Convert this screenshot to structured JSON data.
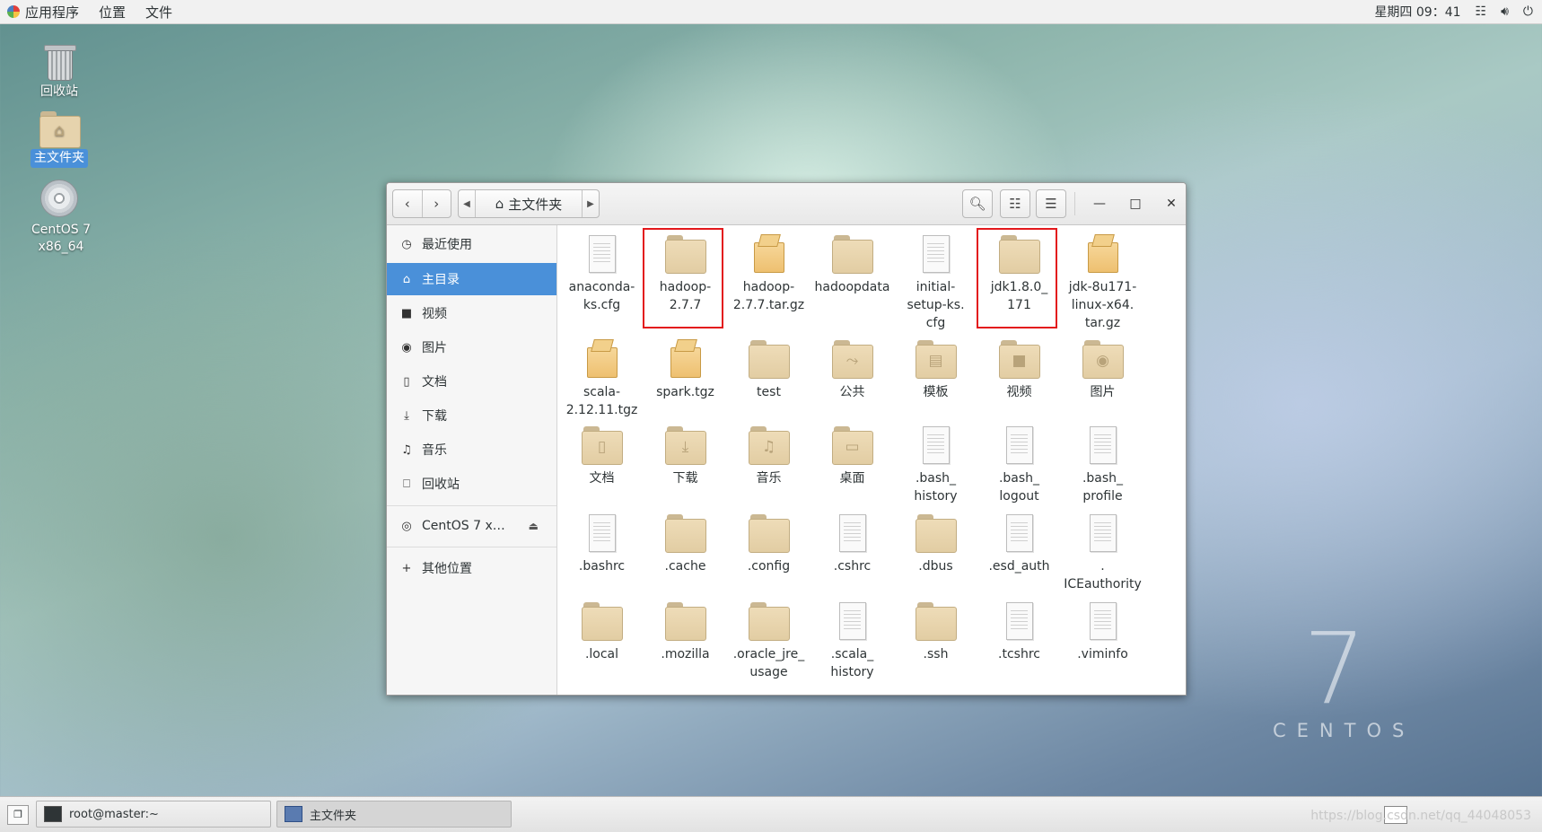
{
  "topbar": {
    "menu": [
      "应用程序",
      "位置",
      "文件"
    ],
    "clock": "星期四 09：41",
    "icons": [
      "network-icon",
      "volume-icon",
      "power-icon"
    ]
  },
  "desktop": {
    "icons": [
      {
        "name": "trash",
        "label": "回收站"
      },
      {
        "name": "home",
        "label": "主文件夹"
      },
      {
        "name": "dvd",
        "label": "CentOS 7 x86_64"
      }
    ],
    "brand_number": "7",
    "brand_text": "CENTOS"
  },
  "window": {
    "path": "主文件夹",
    "sidebar": [
      {
        "label": "最近使用",
        "icon": "clock-icon"
      },
      {
        "label": "主目录",
        "icon": "home-icon",
        "active": true
      },
      {
        "label": "视频",
        "icon": "video-icon"
      },
      {
        "label": "图片",
        "icon": "camera-icon"
      },
      {
        "label": "文档",
        "icon": "document-icon"
      },
      {
        "label": "下载",
        "icon": "download-icon"
      },
      {
        "label": "音乐",
        "icon": "music-icon"
      },
      {
        "label": "回收站",
        "icon": "trash-icon"
      },
      {
        "label": "CentOS 7 x…",
        "icon": "disc-icon",
        "eject": true
      },
      {
        "label": "其他位置",
        "icon": "plus-icon"
      }
    ],
    "files": [
      {
        "label": "anaconda-\nks.cfg",
        "type": "doc"
      },
      {
        "label": "hadoop-\n2.7.7",
        "type": "folder",
        "highlight": true
      },
      {
        "label": "hadoop-\n2.7.7.tar.gz",
        "type": "pkg"
      },
      {
        "label": "hadoopdata",
        "type": "folder"
      },
      {
        "label": "initial-\nsetup-ks.\ncfg",
        "type": "doc"
      },
      {
        "label": "jdk1.8.0_\n171",
        "type": "folder",
        "highlight": true
      },
      {
        "label": "jdk-8u171-\nlinux-x64.\ntar.gz",
        "type": "pkg"
      },
      {
        "label": "scala-\n2.12.11.tgz",
        "type": "pkg"
      },
      {
        "label": "spark.tgz",
        "type": "pkg"
      },
      {
        "label": "test",
        "type": "folder"
      },
      {
        "label": "公共",
        "type": "folder",
        "emblem": "share"
      },
      {
        "label": "模板",
        "type": "folder",
        "emblem": "template"
      },
      {
        "label": "视频",
        "type": "folder",
        "emblem": "video"
      },
      {
        "label": "图片",
        "type": "folder",
        "emblem": "camera"
      },
      {
        "label": "文档",
        "type": "folder",
        "emblem": "document"
      },
      {
        "label": "下载",
        "type": "folder",
        "emblem": "download"
      },
      {
        "label": "音乐",
        "type": "folder",
        "emblem": "music"
      },
      {
        "label": "桌面",
        "type": "folder",
        "emblem": "desktop"
      },
      {
        "label": ".bash_\nhistory",
        "type": "doc"
      },
      {
        "label": ".bash_\nlogout",
        "type": "doc"
      },
      {
        "label": ".bash_\nprofile",
        "type": "doc"
      },
      {
        "label": ".bashrc",
        "type": "doc"
      },
      {
        "label": ".cache",
        "type": "folder"
      },
      {
        "label": ".config",
        "type": "folder"
      },
      {
        "label": ".cshrc",
        "type": "doc"
      },
      {
        "label": ".dbus",
        "type": "folder"
      },
      {
        "label": ".esd_auth",
        "type": "doc"
      },
      {
        "label": ".\nICEauthority",
        "type": "doc"
      },
      {
        "label": ".local",
        "type": "folder"
      },
      {
        "label": ".mozilla",
        "type": "folder"
      },
      {
        "label": ".oracle_jre_\nusage",
        "type": "folder"
      },
      {
        "label": ".scala_\nhistory",
        "type": "doc"
      },
      {
        "label": ".ssh",
        "type": "folder"
      },
      {
        "label": ".tcshrc",
        "type": "doc"
      },
      {
        "label": ".viminfo",
        "type": "doc"
      }
    ]
  },
  "taskbar": {
    "tasks": [
      {
        "label": "root@master:~",
        "icon": "terminal-icon"
      },
      {
        "label": "主文件夹",
        "icon": "files-icon",
        "active": true
      }
    ],
    "watermark": "https://blog.csdn.net/qq_44048053"
  },
  "colors": {
    "accent": "#4a90d9",
    "highlight": "#e3191c",
    "folder": "#e6d3ad"
  }
}
